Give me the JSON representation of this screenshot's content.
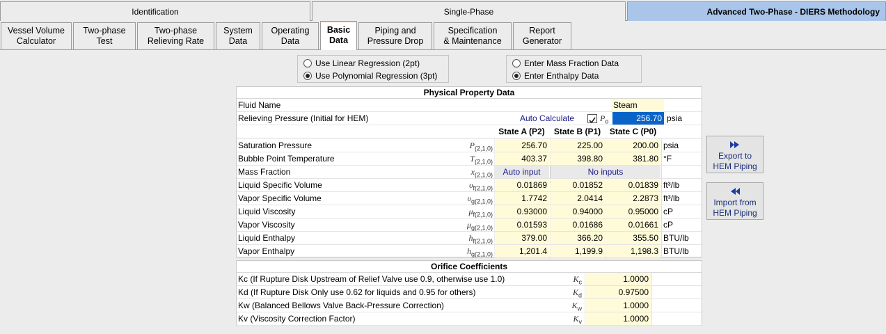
{
  "top_tabs": [
    "Identification",
    "Single-Phase",
    "Advanced Two-Phase - DIERS Methodology"
  ],
  "sub_tabs": [
    [
      "Vessel Volume",
      "Calculator"
    ],
    [
      "Two-phase",
      "Test"
    ],
    [
      "Two-phase",
      "Relieving Rate"
    ],
    [
      "System",
      "Data"
    ],
    [
      "Operating",
      "Data"
    ],
    [
      "Basic",
      "Data"
    ],
    [
      "Piping and",
      "Pressure Drop"
    ],
    [
      "Specification",
      "& Maintenance"
    ],
    [
      "Report",
      "Generator"
    ]
  ],
  "regression": {
    "option1": "Use Linear Regression (2pt)",
    "option2": "Use Polynomial Regression (3pt)",
    "selected": "option2"
  },
  "data_entry": {
    "option1": "Enter Mass Fraction Data",
    "option2": "Enter Enthalpy Data",
    "selected": "option2"
  },
  "physical": {
    "title": "Physical Property Data",
    "fluid_label": "Fluid Name",
    "fluid_value": "Steam",
    "relieving_label": "Relieving Pressure (Initial for HEM)",
    "auto_calc": "Auto Calculate",
    "p0_symbol": "P",
    "p0_sub": "o",
    "p0_value": "256.70",
    "p0_unit": "psia",
    "states": [
      "State A (P2)",
      "State B (P1)",
      "State C (P0)"
    ],
    "rows": [
      {
        "label": "Saturation Pressure",
        "sym": "P",
        "sub": "(2,1,0)",
        "a": "256.70",
        "b": "225.00",
        "c": "200.00",
        "unit": "psia"
      },
      {
        "label": "Bubble Point Temperature",
        "sym": "T",
        "sub": "(2,1,0)",
        "a": "403.37",
        "b": "398.80",
        "c": "381.80",
        "unit": "°F"
      },
      {
        "label": "Mass Fraction",
        "sym": "x",
        "sub": "(2,1,0)",
        "a": "Auto input",
        "bc": "No inputs",
        "unit": ""
      },
      {
        "label": "Liquid Specific Volume",
        "sym": "υ",
        "sub": "f(2,1,0)",
        "a": "0.01869",
        "b": "0.01852",
        "c": "0.01839",
        "unit": "ft³/lb"
      },
      {
        "label": "Vapor Specific Volume",
        "sym": "υ",
        "sub": "g(2,1,0)",
        "a": "1.7742",
        "b": "2.0414",
        "c": "2.2873",
        "unit": "ft³/lb"
      },
      {
        "label": "Liquid Viscosity",
        "sym": "μ",
        "sub": "f(2,1,0)",
        "a": "0.93000",
        "b": "0.94000",
        "c": "0.95000",
        "unit": "cP"
      },
      {
        "label": "Vapor Viscosity",
        "sym": "μ",
        "sub": "g(2,1,0)",
        "a": "0.01593",
        "b": "0.01686",
        "c": "0.01661",
        "unit": "cP"
      },
      {
        "label": "Liquid Enthalpy",
        "sym": "h",
        "sub": "f(2,1,0)",
        "a": "379.00",
        "b": "366.20",
        "c": "355.50",
        "unit": "BTU/lb"
      },
      {
        "label": "Vapor Enthalpy",
        "sym": "h",
        "sub": "g(2,1,0)",
        "a": "1,201.4",
        "b": "1,199.9",
        "c": "1,198.3",
        "unit": "BTU/lb"
      }
    ]
  },
  "orifice": {
    "title": "Orifice Coefficients",
    "rows": [
      {
        "label": "Kc (If Rupture Disk Upstream of Relief Valve use 0.9, otherwise use 1.0)",
        "sym": "K",
        "sub": "c",
        "value": "1.0000"
      },
      {
        "label": "Kd (If Rupture Disk Only use 0.62 for liquids and 0.95 for others)",
        "sym": "K",
        "sub": "d",
        "value": "0.97500"
      },
      {
        "label": "Kw (Balanced Bellows Valve Back-Pressure Correction)",
        "sym": "K",
        "sub": "w",
        "value": "1.0000"
      },
      {
        "label": "Kv (Viscosity Correction Factor)",
        "sym": "K",
        "sub": "v",
        "value": "1.0000"
      }
    ]
  },
  "buttons": {
    "export_line1": "Export to",
    "export_line2": "HEM Piping",
    "import_line1": "Import from",
    "import_line2": "HEM Piping"
  },
  "colors": {
    "active_tab": "#a9c6ea",
    "input_cell": "#fffbd9",
    "highlight": "#0a64c8",
    "button_text": "#1a2e7a"
  }
}
